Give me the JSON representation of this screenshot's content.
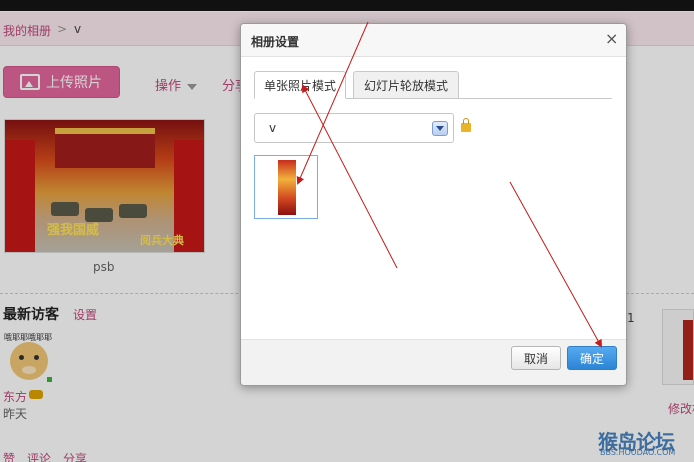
{
  "breadcrumb": {
    "root": "我的相册",
    "separator": ">",
    "current": "v"
  },
  "toolbar": {
    "upload_label": "上传照片",
    "operations_label": "操作",
    "share_label": "分享"
  },
  "album": {
    "name": "psb",
    "thumb_caption": "强我国威",
    "thumb_caption2": "阅兵大典"
  },
  "visitors": {
    "title": "最新访客",
    "settings_label": "设置",
    "items": [
      {
        "avatar_tag": "哦耶耶哦耶耶",
        "name": "东方",
        "time": "昨天"
      }
    ]
  },
  "footer_links": [
    "赞",
    "评论",
    "分享"
  ],
  "right_panel": {
    "count_text": "1",
    "edit_label": "修改相"
  },
  "watermark": {
    "text": "猴岛论坛",
    "url_text": "BBS.HOUDAO.COM"
  },
  "dialog": {
    "title": "相册设置",
    "close_glyph": "×",
    "tabs": [
      {
        "label": "单张照片模式",
        "active": true
      },
      {
        "label": "幻灯片轮放模式",
        "active": false
      }
    ],
    "album_select": {
      "value": "v"
    },
    "cancel_label": "取消",
    "ok_label": "确定"
  },
  "colors": {
    "accent_pink": "#e4679d",
    "link_pink": "#c0487a",
    "annotation_red": "#c41a1a",
    "ok_blue": "#2c84d6"
  },
  "icons": [
    "image-upload-icon",
    "dropdown-arrow-icon",
    "lock-icon",
    "close-icon"
  ]
}
